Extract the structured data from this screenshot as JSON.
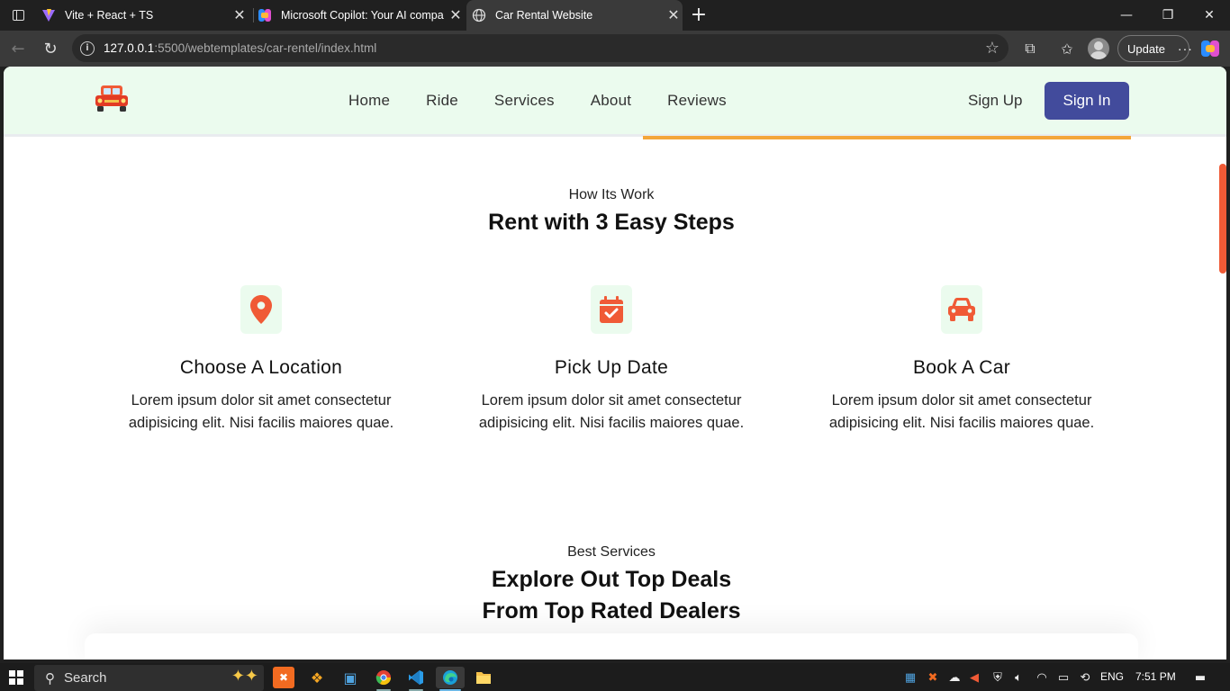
{
  "browser": {
    "tabs": [
      {
        "title": "Vite + React + TS"
      },
      {
        "title": "Microsoft Copilot: Your AI compa"
      },
      {
        "title": "Car Rental Website"
      }
    ],
    "url_host": "127.0.0.1",
    "url_rest": ":5500/webtemplates/car-rentel/index.html",
    "update_label": "Update",
    "more_label": "···"
  },
  "site": {
    "nav": [
      "Home",
      "Ride",
      "Services",
      "About",
      "Reviews"
    ],
    "signup_label": "Sign Up",
    "signin_label": "Sign In",
    "accent_color": "#f05a36",
    "brand_button_color": "#424b9c",
    "header_bg": "#ebfbee",
    "progress_fraction": 0.4
  },
  "how": {
    "subtitle": "How Its Work",
    "title": "Rent with 3 Easy Steps",
    "steps": [
      {
        "icon": "location-pin-icon",
        "title": "Choose A Location",
        "line1": "Lorem ipsum dolor sit amet consectetur",
        "line2": "adipisicing elit. Nisi facilis maiores quae."
      },
      {
        "icon": "calendar-check-icon",
        "title": "Pick Up Date",
        "line1": "Lorem ipsum dolor sit amet consectetur",
        "line2": "adipisicing elit. Nisi facilis maiores quae."
      },
      {
        "icon": "car-icon",
        "title": "Book A Car",
        "line1": "Lorem ipsum dolor sit amet consectetur",
        "line2": "adipisicing elit. Nisi facilis maiores quae."
      }
    ]
  },
  "services": {
    "subtitle": "Best Services",
    "title_line1": "Explore Out Top Deals",
    "title_line2": "From Top Rated Dealers"
  },
  "taskbar": {
    "search_label": "Search",
    "language": "ENG",
    "time": "7:51 PM"
  }
}
